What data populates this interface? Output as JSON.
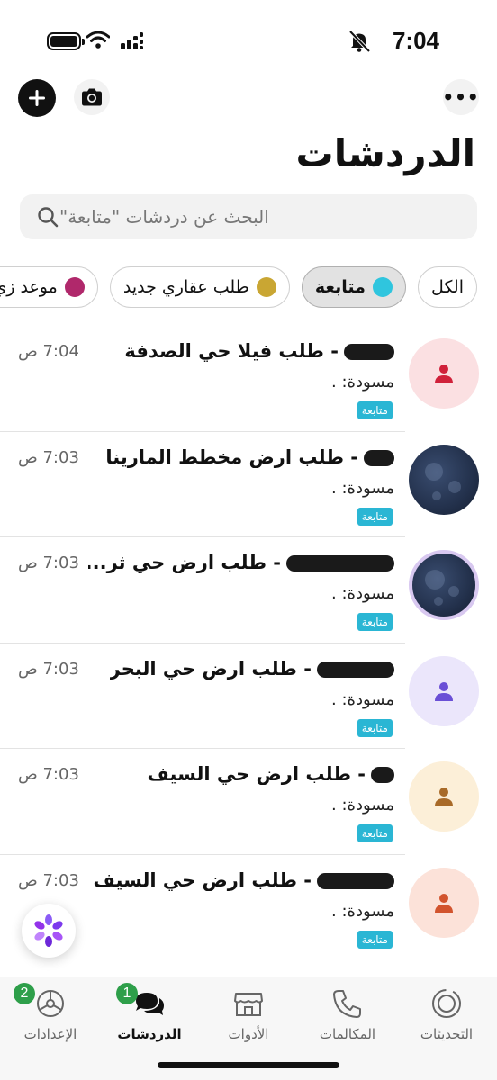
{
  "status": {
    "time": "7:04"
  },
  "header": {
    "title": "الدردشات",
    "more_label": "•••"
  },
  "search": {
    "placeholder": "البحث عن دردشات \"متابعة\""
  },
  "filters": [
    {
      "label": "الكل",
      "dot_color": null,
      "active": false
    },
    {
      "label": "متابعة",
      "dot_color": "#2fc5de",
      "active": true
    },
    {
      "label": "طلب عقاري جديد",
      "dot_color": "#c9a633",
      "active": false
    },
    {
      "label": "موعد زي",
      "dot_color": "#b0286b",
      "active": false
    }
  ],
  "chats": [
    {
      "name": "- طلب فيلا حي الصدفة",
      "time": "7:04 ص",
      "draft": "مسودة: .",
      "tag": "متابعة",
      "avatar": "person",
      "avatar_bg": "#fbe0e2",
      "avatar_fg": "#d0213a"
    },
    {
      "name": "- طلب ارض مخطط المارينا",
      "time": "7:03 ص",
      "draft": "مسودة: .",
      "tag": "متابعة",
      "avatar": "moon",
      "avatar_bg": "#23314c",
      "avatar_fg": null
    },
    {
      "name": "- طلب ارض حي ثر...",
      "time": "7:03 ص",
      "draft": "مسودة: .",
      "tag": "متابعة",
      "avatar": "moon",
      "avatar_bg": "#23314c",
      "avatar_fg": null
    },
    {
      "name": "- طلب ارض حي البحر",
      "time": "7:03 ص",
      "draft": "مسودة: .",
      "tag": "متابعة",
      "avatar": "person",
      "avatar_bg": "#ebe6fb",
      "avatar_fg": "#6a4fd6"
    },
    {
      "name": "- طلب ارض حي السيف",
      "time": "7:03 ص",
      "draft": "مسودة: .",
      "tag": "متابعة",
      "avatar": "person",
      "avatar_bg": "#fcefd8",
      "avatar_fg": "#a86a28"
    },
    {
      "name": "- طلب ارض حي السيف",
      "time": "7:03 ص",
      "draft": "مسودة: .",
      "tag": "متابعة",
      "avatar": "person",
      "avatar_bg": "#fce2d9",
      "avatar_fg": "#d2542e"
    }
  ],
  "tabs": [
    {
      "label": "التحديثات",
      "icon": "updates-icon",
      "badge": null,
      "active": false
    },
    {
      "label": "المكالمات",
      "icon": "phone-icon",
      "badge": null,
      "active": false
    },
    {
      "label": "الأدوات",
      "icon": "store-icon",
      "badge": null,
      "active": false
    },
    {
      "label": "الدردشات",
      "icon": "chats-icon",
      "badge": "1",
      "active": true
    },
    {
      "label": "الإعدادات",
      "icon": "settings-icon",
      "badge": "2",
      "active": false
    }
  ]
}
